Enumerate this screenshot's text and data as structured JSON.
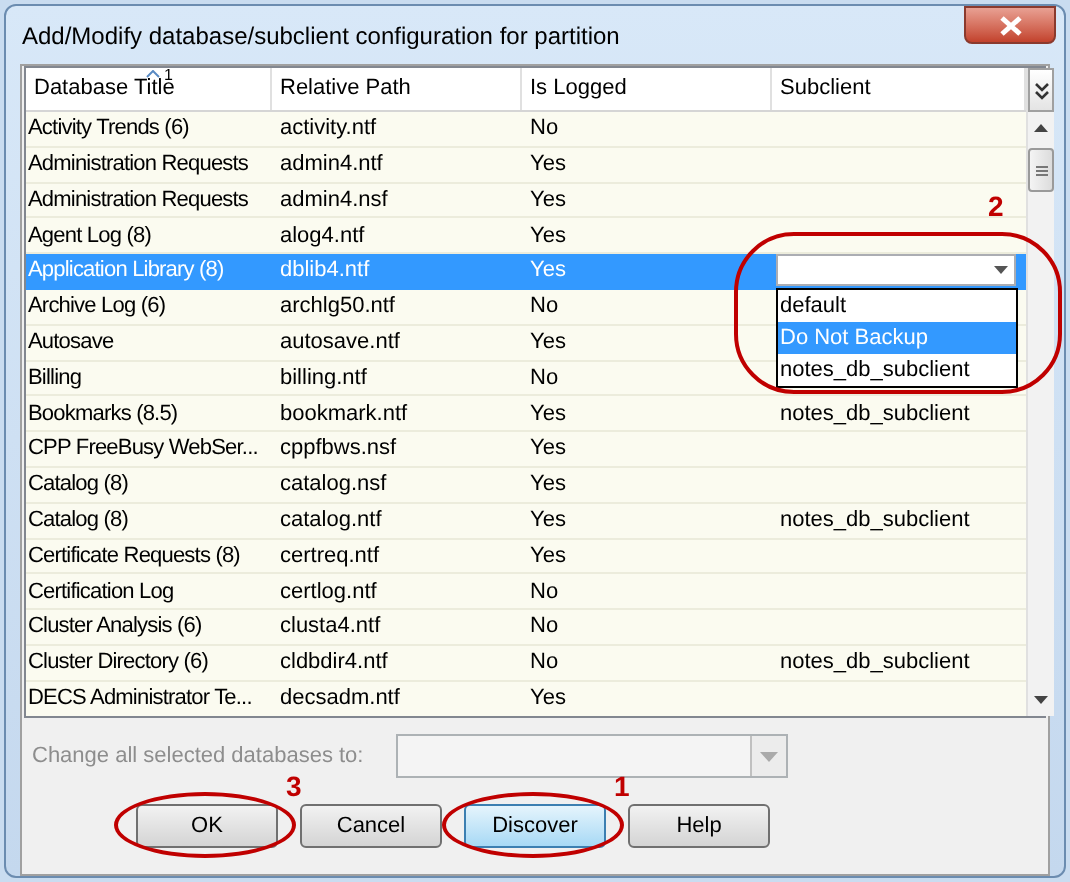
{
  "window": {
    "title": "Add/Modify database/subclient configuration for partition"
  },
  "table": {
    "columns": [
      {
        "label": "Database Title",
        "sorted": true,
        "sort_index": "1"
      },
      {
        "label": "Relative Path",
        "sorted": false
      },
      {
        "label": "Is Logged",
        "sorted": false
      },
      {
        "label": "Subclient",
        "sorted": false
      }
    ],
    "rows": [
      {
        "title": "Activity Trends (6)",
        "path": "activity.ntf",
        "logged": "No",
        "selected": false
      },
      {
        "title": "Administration Requests",
        "path": "admin4.ntf",
        "logged": "Yes",
        "selected": false
      },
      {
        "title": "Administration Requests",
        "path": "admin4.nsf",
        "logged": "Yes",
        "selected": false
      },
      {
        "title": "Agent Log (8)",
        "path": "alog4.ntf",
        "logged": "Yes",
        "selected": false
      },
      {
        "title": "Application Library (8)",
        "path": "dblib4.ntf",
        "logged": "Yes",
        "selected": true
      },
      {
        "title": "Archive Log (6)",
        "path": "archlg50.ntf",
        "logged": "No",
        "selected": false
      },
      {
        "title": "Autosave",
        "path": "autosave.ntf",
        "logged": "Yes",
        "selected": false
      },
      {
        "title": "Billing",
        "path": "billing.ntf",
        "logged": "No",
        "selected": false
      },
      {
        "title": "Bookmarks (8.5)",
        "path": "bookmark.ntf",
        "logged": "Yes",
        "subclient": "notes_db_subclient",
        "selected": false
      },
      {
        "title": "CPP FreeBusy WebSer...",
        "path": "cppfbws.nsf",
        "logged": "Yes",
        "selected": false
      },
      {
        "title": "Catalog (8)",
        "path": "catalog.nsf",
        "logged": "Yes",
        "selected": false
      },
      {
        "title": "Catalog (8)",
        "path": "catalog.ntf",
        "logged": "Yes",
        "subclient": "notes_db_subclient",
        "selected": false
      },
      {
        "title": "Certificate Requests (8)",
        "path": "certreq.ntf",
        "logged": "Yes",
        "selected": false
      },
      {
        "title": "Certification Log",
        "path": "certlog.ntf",
        "logged": "No",
        "selected": false
      },
      {
        "title": "Cluster Analysis (6)",
        "path": "clusta4.ntf",
        "logged": "No",
        "selected": false
      },
      {
        "title": "Cluster Directory (6)",
        "path": "cldbdir4.ntf",
        "logged": "No",
        "subclient": "notes_db_subclient",
        "selected": false
      },
      {
        "title": "DECS Administrator Te...",
        "path": "decsadm.ntf",
        "logged": "Yes",
        "selected": false
      }
    ]
  },
  "subclient_dropdown": {
    "annotation": "2",
    "options": [
      {
        "label": "default",
        "selected": false
      },
      {
        "label": "Do Not Backup",
        "selected": true
      },
      {
        "label": "notes_db_subclient",
        "selected": false
      }
    ]
  },
  "change_all": {
    "label": "Change all selected databases to:",
    "disabled": true
  },
  "buttons": [
    {
      "label": "OK",
      "focused": false,
      "annotation": "3"
    },
    {
      "label": "Cancel",
      "focused": false
    },
    {
      "label": "Discover",
      "focused": true,
      "annotation": "1"
    },
    {
      "label": "Help",
      "focused": false
    }
  ]
}
